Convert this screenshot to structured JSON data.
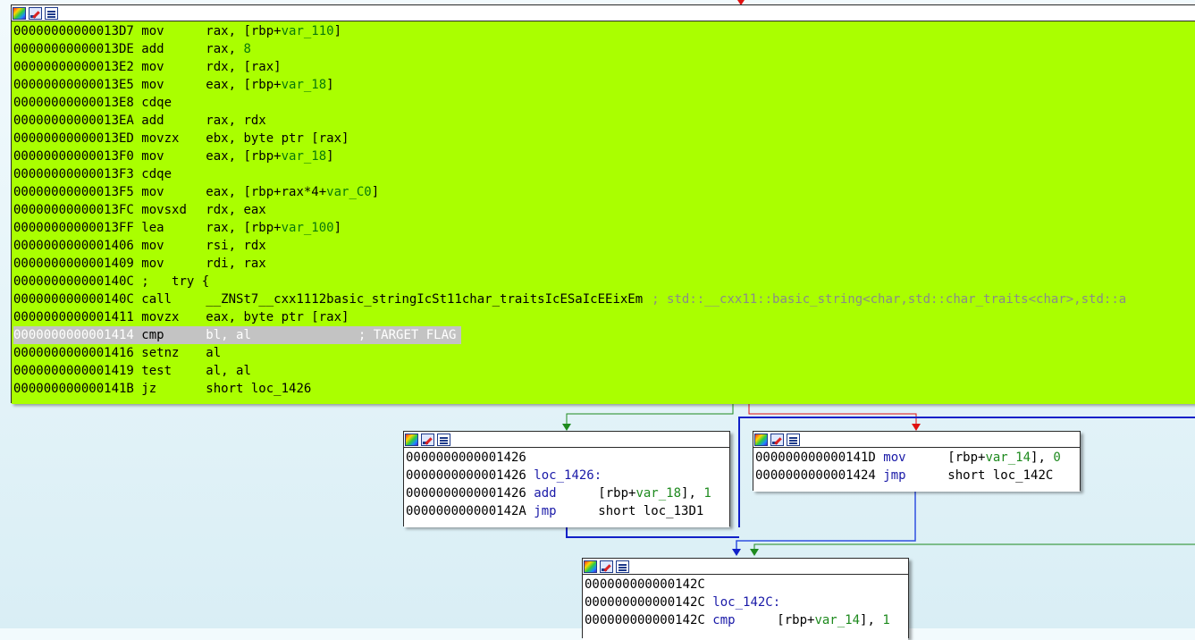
{
  "main_block": {
    "lines": [
      {
        "addr": "00000000000013D7",
        "mn": "mov",
        "pre": "rax, [rbp+",
        "var": "var_110",
        "post": "]"
      },
      {
        "addr": "00000000000013DE",
        "mn": "add",
        "pre": "rax, ",
        "var": "8",
        "post": ""
      },
      {
        "addr": "00000000000013E2",
        "mn": "mov",
        "pre": "rdx, [rax]",
        "var": "",
        "post": ""
      },
      {
        "addr": "00000000000013E5",
        "mn": "mov",
        "pre": "eax, [rbp+",
        "var": "var_18",
        "post": "]"
      },
      {
        "addr": "00000000000013E8",
        "mn": "cdqe",
        "pre": "",
        "var": "",
        "post": ""
      },
      {
        "addr": "00000000000013EA",
        "mn": "add",
        "pre": "rax, rdx",
        "var": "",
        "post": ""
      },
      {
        "addr": "00000000000013ED",
        "mn": "movzx",
        "pre": "ebx, byte ptr [rax]",
        "var": "",
        "post": ""
      },
      {
        "addr": "00000000000013F0",
        "mn": "mov",
        "pre": "eax, [rbp+",
        "var": "var_18",
        "post": "]"
      },
      {
        "addr": "00000000000013F3",
        "mn": "cdqe",
        "pre": "",
        "var": "",
        "post": ""
      },
      {
        "addr": "00000000000013F5",
        "mn": "mov",
        "pre": "eax, [rbp+rax*4+",
        "var": "var_C0",
        "post": "]"
      },
      {
        "addr": "00000000000013FC",
        "mn": "movsxd",
        "pre": "rdx, eax",
        "var": "",
        "post": ""
      },
      {
        "addr": "00000000000013FF",
        "mn": "lea",
        "pre": "rax, [rbp+",
        "var": "var_100",
        "post": "]"
      },
      {
        "addr": "0000000000001406",
        "mn": "mov",
        "pre": "rsi, rdx",
        "var": "",
        "post": ""
      },
      {
        "addr": "0000000000001409",
        "mn": "mov",
        "pre": "rdi, rax",
        "var": "",
        "post": ""
      },
      {
        "addr": "000000000000140C",
        "mn": ";   try {",
        "pre": "",
        "var": "",
        "post": ""
      },
      {
        "addr": "000000000000140C",
        "mn": "call",
        "pre": "__ZNSt7__cxx1112basic_stringIcSt11char_traitsIcESaIcEEixEm",
        "var": "",
        "post": "",
        "cmt": "; std::__cxx11::basic_string<char,std::char_traits<char>,std::a"
      },
      {
        "addr": "0000000000001411",
        "mn": "movzx",
        "pre": "eax, byte ptr [rax]",
        "var": "",
        "post": ""
      },
      {
        "addr": "0000000000001414",
        "mn": "cmp",
        "pre": "bl, al",
        "var": "",
        "post": "",
        "cmt": "; TARGET FLAG",
        "highlight": true
      },
      {
        "addr": "0000000000001416",
        "mn": "setnz",
        "pre": "al",
        "var": "",
        "post": ""
      },
      {
        "addr": "0000000000001419",
        "mn": "test",
        "pre": "al, al",
        "var": "",
        "post": ""
      },
      {
        "addr": "000000000000141B",
        "mn": "jz",
        "pre": "short loc_1426",
        "var": "",
        "post": ""
      }
    ]
  },
  "block_1426": {
    "lines": [
      {
        "addr": "0000000000001426",
        "mn": "",
        "pre": "",
        "var": "",
        "post": ""
      },
      {
        "addr": "0000000000001426",
        "mn": "loc_1426:",
        "pre": "",
        "var": "",
        "post": ""
      },
      {
        "addr": "0000000000001426",
        "mn": "add",
        "pre": "[rbp+",
        "var": "var_18",
        "post": "], ",
        "num": "1"
      },
      {
        "addr": "000000000000142A",
        "mn": "jmp",
        "pre": "short loc_13D1",
        "var": "",
        "post": ""
      }
    ]
  },
  "block_141D": {
    "lines": [
      {
        "addr": "000000000000141D",
        "mn": "mov",
        "pre": "[rbp+",
        "var": "var_14",
        "post": "], ",
        "num": "0"
      },
      {
        "addr": "0000000000001424",
        "mn": "jmp",
        "pre": "short loc_142C",
        "var": "",
        "post": ""
      }
    ]
  },
  "block_142C": {
    "lines": [
      {
        "addr": "000000000000142C",
        "mn": "",
        "pre": "",
        "var": "",
        "post": ""
      },
      {
        "addr": "000000000000142C",
        "mn": "loc_142C:",
        "pre": "",
        "var": "",
        "post": ""
      },
      {
        "addr": "000000000000142C",
        "mn": "cmp",
        "pre": "[rbp+",
        "var": "var_14",
        "post": "], ",
        "num": "1"
      }
    ]
  },
  "colors": {
    "main_bg": "#aaff00",
    "edge_true": "#1e8a1e",
    "edge_false": "#e01010",
    "edge_jump": "#1020c8",
    "highlight": "#c3c3c3"
  },
  "icons": [
    "graph-overview-icon",
    "edit-node-icon",
    "xrefs-icon"
  ]
}
